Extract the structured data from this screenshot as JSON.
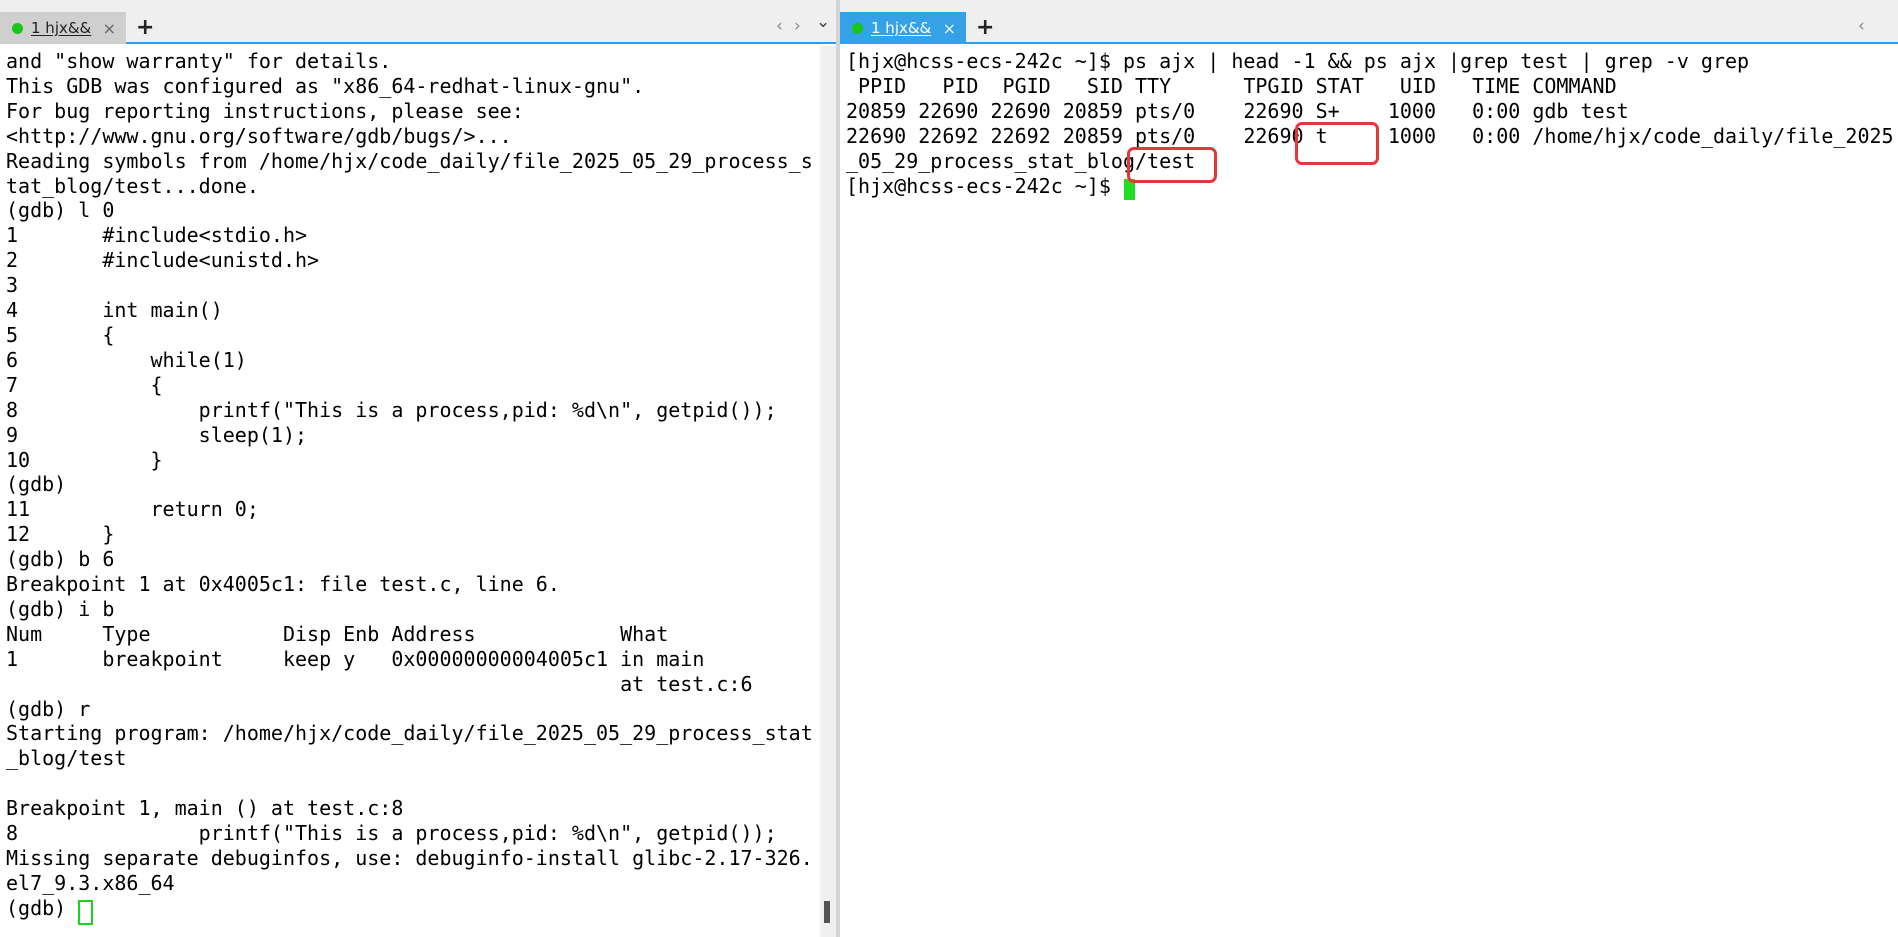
{
  "left": {
    "tab": {
      "label": "1 hjx&&",
      "close": "×"
    },
    "new_tab": "+",
    "nav_prev": "‹",
    "nav_next": "›",
    "nav_menu": "⌄",
    "lines": [
      "and \"show warranty\" for details.",
      "This GDB was configured as \"x86_64-redhat-linux-gnu\".",
      "For bug reporting instructions, please see:",
      "<http://www.gnu.org/software/gdb/bugs/>...",
      "Reading symbols from /home/hjx/code_daily/file_2025_05_29_process_s",
      "tat_blog/test...done.",
      "(gdb) l 0",
      "1       #include<stdio.h>",
      "2       #include<unistd.h>",
      "3",
      "4       int main()",
      "5       {",
      "6           while(1)",
      "7           {",
      "8               printf(\"This is a process,pid: %d\\n\", getpid());",
      "9               sleep(1);",
      "10          }",
      "(gdb)",
      "11          return 0;",
      "12      }",
      "(gdb) b 6",
      "Breakpoint 1 at 0x4005c1: file test.c, line 6.",
      "(gdb) i b",
      "Num     Type           Disp Enb Address            What",
      "1       breakpoint     keep y   0x00000000004005c1 in main",
      "                                                   at test.c:6",
      "(gdb) r",
      "Starting program: /home/hjx/code_daily/file_2025_05_29_process_stat",
      "_blog/test",
      "",
      "Breakpoint 1, main () at test.c:8",
      "8               printf(\"This is a process,pid: %d\\n\", getpid());",
      "Missing separate debuginfos, use: debuginfo-install glibc-2.17-326.",
      "el7_9.3.x86_64",
      "(gdb) "
    ]
  },
  "right": {
    "tab": {
      "label": "1 hjx&&",
      "close": "×"
    },
    "new_tab": "+",
    "nav_prev": "‹",
    "lines": [
      "[hjx@hcss-ecs-242c ~]$ ps ajx | head -1 && ps ajx |grep test | grep -v grep",
      " PPID   PID  PGID   SID TTY      TPGID STAT   UID   TIME COMMAND",
      "20859 22690 22690 20859 pts/0    22690 S+    1000   0:00 gdb test",
      "22690 22692 22692 20859 pts/0    22690 t     1000   0:00 /home/hjx/code_daily/file_2025",
      "_05_29_process_stat_blog/test",
      "[hjx@hcss-ecs-242c ~]$ "
    ]
  },
  "colors": {
    "highlight": "#e0393b",
    "active_tab": "#35a2e8",
    "status_dot": "#19c41c",
    "cursor": "#22dd22"
  }
}
